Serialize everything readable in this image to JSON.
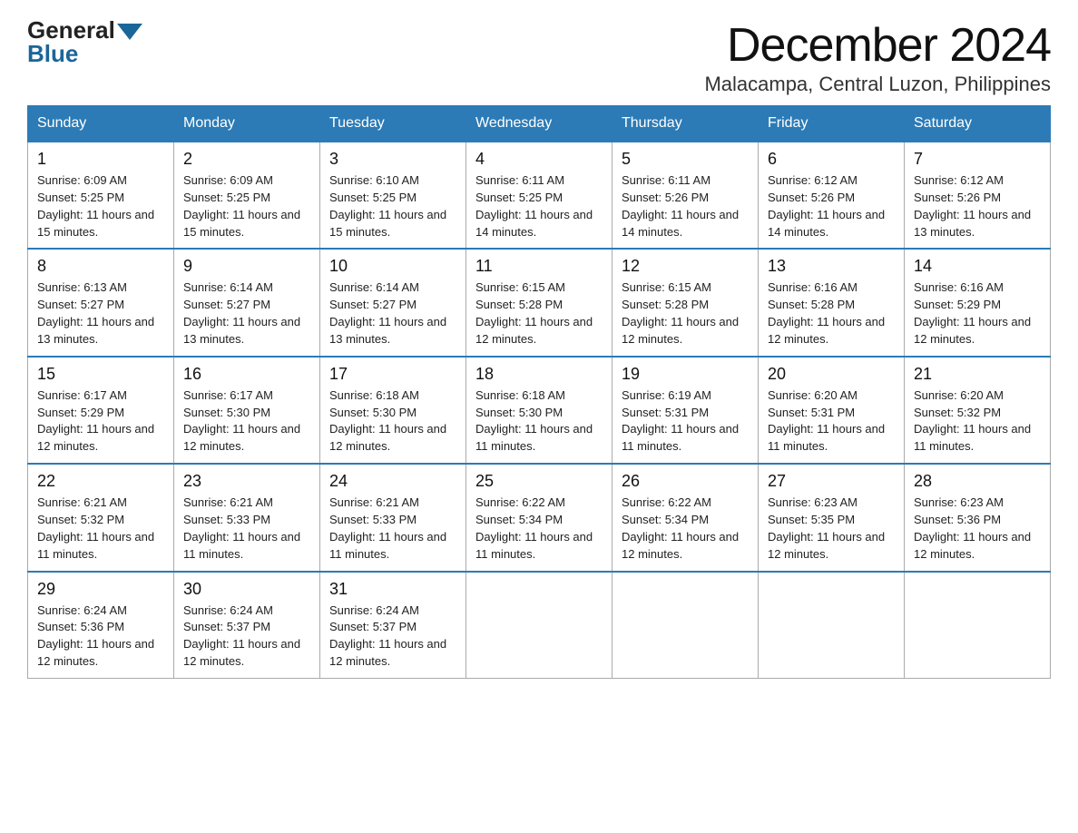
{
  "header": {
    "logo_general": "General",
    "logo_blue": "Blue",
    "title": "December 2024",
    "subtitle": "Malacampa, Central Luzon, Philippines"
  },
  "weekdays": [
    "Sunday",
    "Monday",
    "Tuesday",
    "Wednesday",
    "Thursday",
    "Friday",
    "Saturday"
  ],
  "weeks": [
    [
      {
        "day": "1",
        "sunrise": "6:09 AM",
        "sunset": "5:25 PM",
        "daylight": "11 hours and 15 minutes."
      },
      {
        "day": "2",
        "sunrise": "6:09 AM",
        "sunset": "5:25 PM",
        "daylight": "11 hours and 15 minutes."
      },
      {
        "day": "3",
        "sunrise": "6:10 AM",
        "sunset": "5:25 PM",
        "daylight": "11 hours and 15 minutes."
      },
      {
        "day": "4",
        "sunrise": "6:11 AM",
        "sunset": "5:25 PM",
        "daylight": "11 hours and 14 minutes."
      },
      {
        "day": "5",
        "sunrise": "6:11 AM",
        "sunset": "5:26 PM",
        "daylight": "11 hours and 14 minutes."
      },
      {
        "day": "6",
        "sunrise": "6:12 AM",
        "sunset": "5:26 PM",
        "daylight": "11 hours and 14 minutes."
      },
      {
        "day": "7",
        "sunrise": "6:12 AM",
        "sunset": "5:26 PM",
        "daylight": "11 hours and 13 minutes."
      }
    ],
    [
      {
        "day": "8",
        "sunrise": "6:13 AM",
        "sunset": "5:27 PM",
        "daylight": "11 hours and 13 minutes."
      },
      {
        "day": "9",
        "sunrise": "6:14 AM",
        "sunset": "5:27 PM",
        "daylight": "11 hours and 13 minutes."
      },
      {
        "day": "10",
        "sunrise": "6:14 AM",
        "sunset": "5:27 PM",
        "daylight": "11 hours and 13 minutes."
      },
      {
        "day": "11",
        "sunrise": "6:15 AM",
        "sunset": "5:28 PM",
        "daylight": "11 hours and 12 minutes."
      },
      {
        "day": "12",
        "sunrise": "6:15 AM",
        "sunset": "5:28 PM",
        "daylight": "11 hours and 12 minutes."
      },
      {
        "day": "13",
        "sunrise": "6:16 AM",
        "sunset": "5:28 PM",
        "daylight": "11 hours and 12 minutes."
      },
      {
        "day": "14",
        "sunrise": "6:16 AM",
        "sunset": "5:29 PM",
        "daylight": "11 hours and 12 minutes."
      }
    ],
    [
      {
        "day": "15",
        "sunrise": "6:17 AM",
        "sunset": "5:29 PM",
        "daylight": "11 hours and 12 minutes."
      },
      {
        "day": "16",
        "sunrise": "6:17 AM",
        "sunset": "5:30 PM",
        "daylight": "11 hours and 12 minutes."
      },
      {
        "day": "17",
        "sunrise": "6:18 AM",
        "sunset": "5:30 PM",
        "daylight": "11 hours and 12 minutes."
      },
      {
        "day": "18",
        "sunrise": "6:18 AM",
        "sunset": "5:30 PM",
        "daylight": "11 hours and 11 minutes."
      },
      {
        "day": "19",
        "sunrise": "6:19 AM",
        "sunset": "5:31 PM",
        "daylight": "11 hours and 11 minutes."
      },
      {
        "day": "20",
        "sunrise": "6:20 AM",
        "sunset": "5:31 PM",
        "daylight": "11 hours and 11 minutes."
      },
      {
        "day": "21",
        "sunrise": "6:20 AM",
        "sunset": "5:32 PM",
        "daylight": "11 hours and 11 minutes."
      }
    ],
    [
      {
        "day": "22",
        "sunrise": "6:21 AM",
        "sunset": "5:32 PM",
        "daylight": "11 hours and 11 minutes."
      },
      {
        "day": "23",
        "sunrise": "6:21 AM",
        "sunset": "5:33 PM",
        "daylight": "11 hours and 11 minutes."
      },
      {
        "day": "24",
        "sunrise": "6:21 AM",
        "sunset": "5:33 PM",
        "daylight": "11 hours and 11 minutes."
      },
      {
        "day": "25",
        "sunrise": "6:22 AM",
        "sunset": "5:34 PM",
        "daylight": "11 hours and 11 minutes."
      },
      {
        "day": "26",
        "sunrise": "6:22 AM",
        "sunset": "5:34 PM",
        "daylight": "11 hours and 12 minutes."
      },
      {
        "day": "27",
        "sunrise": "6:23 AM",
        "sunset": "5:35 PM",
        "daylight": "11 hours and 12 minutes."
      },
      {
        "day": "28",
        "sunrise": "6:23 AM",
        "sunset": "5:36 PM",
        "daylight": "11 hours and 12 minutes."
      }
    ],
    [
      {
        "day": "29",
        "sunrise": "6:24 AM",
        "sunset": "5:36 PM",
        "daylight": "11 hours and 12 minutes."
      },
      {
        "day": "30",
        "sunrise": "6:24 AM",
        "sunset": "5:37 PM",
        "daylight": "11 hours and 12 minutes."
      },
      {
        "day": "31",
        "sunrise": "6:24 AM",
        "sunset": "5:37 PM",
        "daylight": "11 hours and 12 minutes."
      },
      null,
      null,
      null,
      null
    ]
  ]
}
